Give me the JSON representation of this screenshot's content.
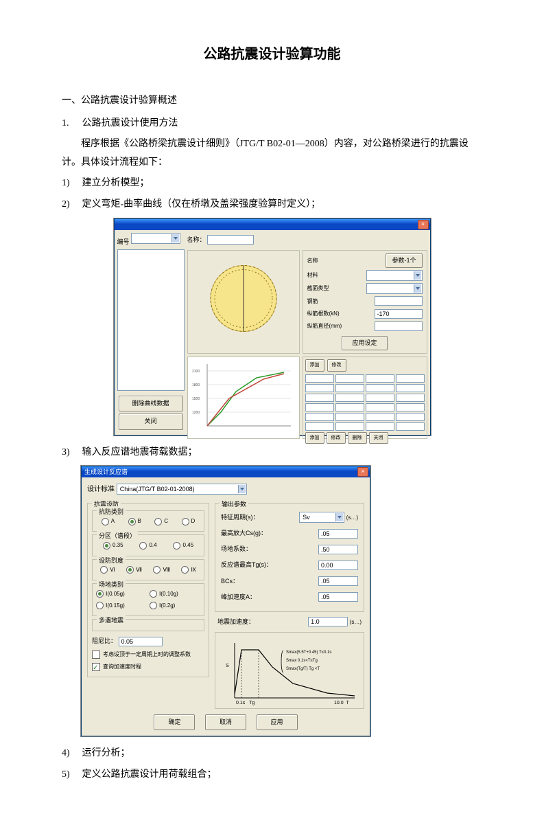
{
  "title": "公路抗震设计验算功能",
  "section1": "一、公路抗震设计验算概述",
  "item1_num": "1.",
  "item1_text": "公路抗震设计使用方法",
  "para1": "程序根据《公路桥梁抗震设计细则》（JTG/T B02-01—2008）内容，对公路桥梁进行的抗震设计。具体设计流程如下：",
  "step1_num": "1)",
  "step1_text": "建立分析模型；",
  "step2_num": "2)",
  "step2_text": "定义弯矩-曲率曲线（仅在桥墩及盖梁强度验算时定义）；",
  "step3_num": "3)",
  "step3_text": "输入反应谱地震荷载数据；",
  "step4_num": "4)",
  "step4_text": "运行分析；",
  "step5_num": "5)",
  "step5_text": "定义公路抗震设计用荷载组合；",
  "dialog1": {
    "title_label": "名称：",
    "label_num": "编号",
    "btn_del": "删除曲线数据",
    "btn_close": "关闭",
    "prop_name_label": "名称",
    "prop_name_val": "参数-1个",
    "props": [
      {
        "l": "材料",
        "v": ""
      },
      {
        "l": "截面类型",
        "v": ""
      },
      {
        "l": "钢筋",
        "v": ""
      },
      {
        "l": "纵筋根数(kN)",
        "v": "-170"
      },
      {
        "l": "纵筋直径(mm)",
        "v": ""
      }
    ],
    "btn_apply": "应用设定",
    "btn_add": "添加",
    "btn_mod": "修改",
    "bottom_buttons": [
      "添加",
      "修改",
      "删除",
      "关闭"
    ]
  },
  "dialog2": {
    "title": "生成设计反应谱",
    "spec_label": "设计标准",
    "spec_value": "China(JTG/T B02-01-2008)",
    "grp_fortification": "抗震设防",
    "grp_seismic_category": "抗防类别",
    "cat_options": [
      "A",
      "B",
      "C",
      "D"
    ],
    "grp_region": "分区（谱段）",
    "region_options": [
      "0.35",
      "0.4",
      "0.45"
    ],
    "grp_intensity": "设防烈度",
    "intensity_options": [
      "Ⅵ",
      "Ⅶ",
      "Ⅷ",
      "Ⅸ"
    ],
    "grp_site": "场地类别",
    "site_options": [
      "Ⅰ(0.05g)",
      "Ⅰ(0.10g)",
      "Ⅰ(0.15g)",
      "Ⅰ(0.2g)"
    ],
    "grp_earthquake": "多遇地震",
    "damp_label": "阻尼比：",
    "damp_value": "0.05",
    "chk1_label": "考虑设顶于一定周期上时的调整系数",
    "chk2_label": "查询加速度时程",
    "grp_two": "输出参数",
    "param_lines": [
      {
        "l": "特征周期(s)：",
        "v": "Sv",
        "ext": "(s…)"
      },
      {
        "l": "最高放大Cs(g)：",
        "v": ".05"
      },
      {
        "l": "场地系数：",
        "v": ".50"
      },
      {
        "l": "反应谱最高Tg(s)：",
        "v": "0.00"
      },
      {
        "l": "BCs：",
        "v": ".05"
      },
      {
        "l": "峰加速度A：",
        "v": ".05"
      },
      {
        "l": "地震加速度：",
        "v": "1.0",
        "ext": "(s…)"
      }
    ],
    "plot_lbl1": "0.1s   Tg",
    "plot_lbl2": "10.0   T",
    "formula_top": "Smax(5.5T+0.45)  T≤0.1s",
    "formula_mid": "Smax            0.1s<T≤Tg",
    "formula_bot": "Smax(Tg/T)      Tg <T",
    "btn_ok": "确定",
    "btn_cancel": "取消",
    "btn_apply": "应用"
  }
}
